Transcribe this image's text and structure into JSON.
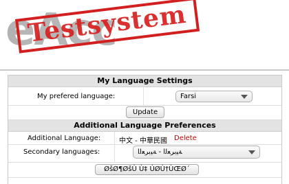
{
  "header": {
    "logo_text": "eAcc",
    "stamp_text": "Testsystem"
  },
  "my_language_settings": {
    "title": "My Language Settings",
    "preferred_label": "My prefered language:",
    "preferred_value": "Farsi",
    "update_label": "Update"
  },
  "additional_prefs": {
    "title": "Additional Language Preferences",
    "additional_label": "Additional Language:",
    "additional_value": "中文 - 中華民國",
    "delete_label": "Delete",
    "secondary_label": "Secondary languages:",
    "secondary_value": "ﺔﻴﺑﺮﻌﻟﺍ - ﺔﻴﺑﺮﻌﻟﺍ",
    "add_button_label": "ØšØ¶ØšÙ Ù‡ ÚØÙ†ÙŒØ´"
  }
}
